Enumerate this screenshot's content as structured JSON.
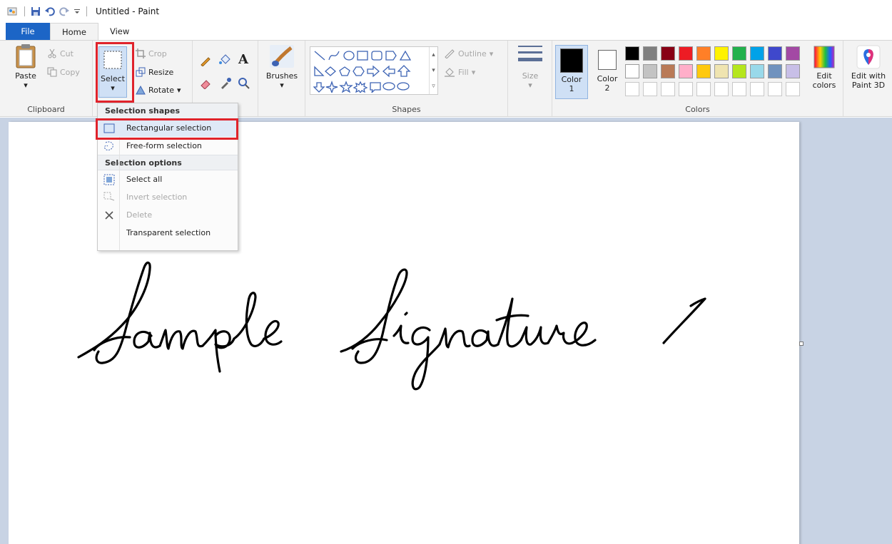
{
  "window": {
    "title": "Untitled - Paint"
  },
  "tabs": [
    {
      "label": "File"
    },
    {
      "label": "Home"
    },
    {
      "label": "View"
    }
  ],
  "clipboard": {
    "paste": "Paste",
    "cut": "Cut",
    "copy": "Copy",
    "group": "Clipboard"
  },
  "image": {
    "select": "Select",
    "crop": "Crop",
    "resize": "Resize",
    "rotate": "Rotate"
  },
  "brushes": {
    "label": "Brushes"
  },
  "shapes": {
    "outline": "Outline",
    "fill": "Fill",
    "group": "Shapes"
  },
  "size": {
    "label": "Size"
  },
  "colors": {
    "color1": "Color\n1",
    "color1_a": "Color",
    "color1_b": "1",
    "color2_a": "Color",
    "color2_b": "2",
    "edit_a": "Edit",
    "edit_b": "colors",
    "paint3d_a": "Edit with",
    "paint3d_b": "Paint 3D",
    "group": "Colors",
    "row1": [
      "#000000",
      "#7f7f7f",
      "#880015",
      "#ed1c24",
      "#ff7f27",
      "#fff200",
      "#22b14c",
      "#00a2e8",
      "#3f48cc",
      "#a349a4"
    ],
    "row2": [
      "#ffffff",
      "#c3c3c3",
      "#b97a57",
      "#ffaec9",
      "#ffc90e",
      "#efe4b0",
      "#b5e61d",
      "#99d9ea",
      "#7092be",
      "#c8bfe7"
    ]
  },
  "menu": {
    "section1": "Selection shapes",
    "rect": "Rectangular selection",
    "freeform": "Free-form selection",
    "section2": "Selection options",
    "select_all": "Select all",
    "invert": "Invert selection",
    "delete": "Delete",
    "transparent": "Transparent selection"
  },
  "canvas": {
    "signature": "Sample Signature 1"
  }
}
